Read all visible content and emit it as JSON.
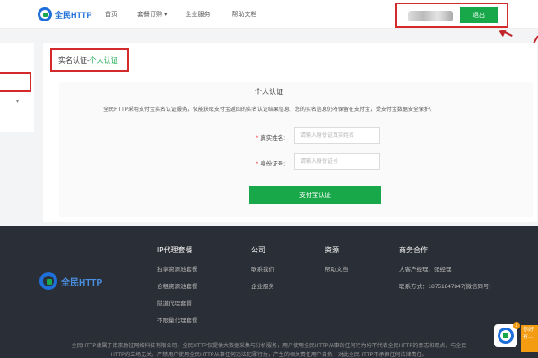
{
  "header": {
    "logo_text": "全民HTTP",
    "nav": [
      {
        "label": "首页"
      },
      {
        "label": "套餐订购",
        "caret": "▾"
      },
      {
        "label": "企业服务"
      },
      {
        "label": "帮助文档"
      }
    ],
    "logout_label": "退出"
  },
  "sidebar": {
    "chevron": "▾"
  },
  "breadcrumb": {
    "base": "实名认证-",
    "current": "个人认证"
  },
  "verify": {
    "title": "个人认证",
    "notice": "全民HTTP采用支付宝实名认证服务，仅能获取支付宝返回的实名认证结果信息，您的实名信息仍将保留在支付宝，受支付宝数据安全保护。",
    "name_label": "真实姓名:",
    "name_placeholder": "请输入身份证真实姓名",
    "id_label": "身份证号:",
    "id_placeholder": "请输入身份证号",
    "required_mark": "*",
    "submit_label": "支付宝认证"
  },
  "footer": {
    "logo_text": "全民HTTP",
    "columns": [
      {
        "title": "IP代理套餐",
        "items": [
          "独享资源池套餐",
          "合租资源池套餐",
          "隧道代理套餐",
          "不限量代理套餐"
        ]
      },
      {
        "title": "公司",
        "items": [
          "联系我们",
          "企业服务"
        ]
      },
      {
        "title": "资源",
        "items": [
          "帮助文档"
        ]
      },
      {
        "title": "商务合作",
        "items": [
          "大客户经理：张经理",
          "联系方式：18751847847(微信同号)"
        ]
      }
    ],
    "disclaimer_1": "全民HTTP隶属于南京励征网络科技有限公司，全民HTTP仅提供大数据采集与分析服务，用户使用全民HTTP从事的任何行为均不代表全民HTTP的意志和观点，与全民",
    "disclaimer_2": "HTTP的立场无关。严禁用户使用全民HTTP从事任何违法犯罪行为，产生的相关责任用户自负，对此全民HTTP不承担任何法律责任。"
  },
  "float_widget": {
    "badge": "1",
    "side_text": "你好有…"
  },
  "colors": {
    "accent_green": "#18a84a",
    "brand_blue": "#1e6fd9",
    "highlight_red": "#d32b2b",
    "footer_bg": "#2a2e36"
  }
}
